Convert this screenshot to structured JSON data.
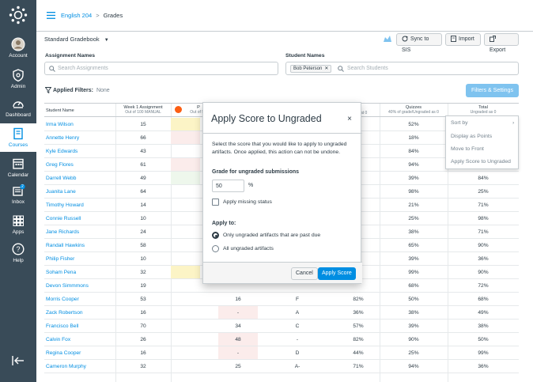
{
  "nav": {
    "items": [
      {
        "label": "Account",
        "icon": "account-icon"
      },
      {
        "label": "Admin",
        "icon": "admin-shield-icon"
      },
      {
        "label": "Dashboard",
        "icon": "dashboard-icon"
      },
      {
        "label": "Courses",
        "icon": "courses-book-icon"
      },
      {
        "label": "Calendar",
        "icon": "calendar-icon"
      },
      {
        "label": "Inbox",
        "icon": "inbox-icon",
        "badge": "2"
      },
      {
        "label": "Apps",
        "icon": "apps-grid-icon"
      },
      {
        "label": "Help",
        "icon": "help-icon"
      }
    ],
    "active": "Courses"
  },
  "breadcrumb": {
    "course": "English 204",
    "sep": ">",
    "page": "Grades"
  },
  "toolbar": {
    "gradebook_menu": "Standard Gradebook",
    "sync_label": "Sync to SIS",
    "import_label": "Import",
    "export_label": "Export"
  },
  "search": {
    "assignment_label": "Assignment Names",
    "assignment_placeholder": "Search Assignments",
    "student_label": "Student Names",
    "student_chip": "Bob Peterson",
    "student_placeholder": "Search Students"
  },
  "filters": {
    "label": "Applied Filters:",
    "value": "None",
    "button": "Filters & Settings"
  },
  "grid": {
    "headers": {
      "student": "Student Name",
      "week1": "Week 1 Assignment",
      "week1_sub": "Out of 100 MANUAL",
      "col2": "P",
      "col2_sub": "Out of 5C",
      "col3_sub": "at 0",
      "quizzes": "Quizzes",
      "quizzes_sub": "40% of grade/Ungraded as 0",
      "total": "Total",
      "total_sub": "Ungraded as 0"
    },
    "rows": [
      {
        "name": "Irma Wilson",
        "w1": "15",
        "c2": "",
        "c3": "",
        "c4": "",
        "quiz": "52%",
        "total": ""
      },
      {
        "name": "Annette Henry",
        "w1": "66",
        "c2": "",
        "c3": "",
        "c4": "",
        "quiz": "18%",
        "total": ""
      },
      {
        "name": "Kyle Edwards",
        "w1": "43",
        "c2": "",
        "c3": "",
        "c4": "",
        "quiz": "84%",
        "total": ""
      },
      {
        "name": "Greg Flores",
        "w1": "61",
        "c2": "",
        "c3": "",
        "c4": "",
        "quiz": "94%",
        "total": ""
      },
      {
        "name": "Darrell Webb",
        "w1": "49",
        "c2": "",
        "c3": "",
        "c4": "",
        "quiz": "39%",
        "total": "84%"
      },
      {
        "name": "Juanita Lane",
        "w1": "64",
        "c2": "",
        "c3": "",
        "c4": "",
        "quiz": "98%",
        "total": "25%"
      },
      {
        "name": "Timothy Howard",
        "w1": "14",
        "c2": "",
        "c3": "",
        "c4": "",
        "quiz": "21%",
        "total": "71%"
      },
      {
        "name": "Connie Russell",
        "w1": "10",
        "c2": "",
        "c3": "",
        "c4": "",
        "quiz": "25%",
        "total": "98%"
      },
      {
        "name": "Jane Richards",
        "w1": "24",
        "c2": "",
        "c3": "",
        "c4": "",
        "quiz": "38%",
        "total": "71%"
      },
      {
        "name": "Randall Hawkins",
        "w1": "58",
        "c2": "",
        "c3": "",
        "c4": "",
        "quiz": "65%",
        "total": "90%"
      },
      {
        "name": "Philip Fisher",
        "w1": "10",
        "c2": "",
        "c3": "",
        "c4": "",
        "quiz": "39%",
        "total": "36%"
      },
      {
        "name": "Soham Pena",
        "w1": "32",
        "c2": "",
        "c3": "",
        "c4": "",
        "quiz": "99%",
        "total": "90%"
      },
      {
        "name": "Devon Simmmons",
        "w1": "19",
        "c2": "",
        "c3": "",
        "c4": "",
        "quiz": "68%",
        "total": "72%"
      },
      {
        "name": "Morris Cooper",
        "w1": "53",
        "c2": "16",
        "c3": "F",
        "c4": "82%",
        "quiz": "50%",
        "total": "68%"
      },
      {
        "name": "Zack Robertson",
        "w1": "16",
        "c2": "-",
        "c3": "A",
        "c4": "36%",
        "quiz": "38%",
        "total": "49%"
      },
      {
        "name": "Francisco Bell",
        "w1": "70",
        "c2": "34",
        "c3": "C",
        "c4": "57%",
        "quiz": "39%",
        "total": "38%"
      },
      {
        "name": "Calvin Fox",
        "w1": "26",
        "c2": "48",
        "c3": "-",
        "c4": "82%",
        "quiz": "90%",
        "total": "50%"
      },
      {
        "name": "Regina Cooper",
        "w1": "16",
        "c2": "-",
        "c3": "D",
        "c4": "44%",
        "quiz": "25%",
        "total": "99%"
      },
      {
        "name": "Cameron Murphy",
        "w1": "32",
        "c2": "25",
        "c3": "A-",
        "c4": "71%",
        "quiz": "94%",
        "total": "36%"
      }
    ]
  },
  "header_menu": {
    "items": [
      "Sort by",
      "Display as Points",
      "Move to Front",
      "Apply Score to Ungraded"
    ]
  },
  "modal": {
    "title": "Apply Score to Ungraded",
    "close": "×",
    "description": "Select the score that you would like to apply to ungraded artifacts.  Once applied, this action can not be undone.",
    "grade_label": "Grade for ungraded submissions",
    "grade_value": "50",
    "pct": "%",
    "missing_label": "Apply missing status",
    "apply_to_label": "Apply to:",
    "option1": "Only ungraded artifacts that are past due",
    "option2": "All ungraded artifacts",
    "cancel": "Cancel",
    "apply": "Apply Score"
  },
  "colors": {
    "nav_bg": "#394b58",
    "link": "#008ee2",
    "primary": "#008ee2",
    "missing_yellow": "#fcf4c6",
    "late_red": "#fbeceb",
    "late_green": "#eef7ec"
  }
}
